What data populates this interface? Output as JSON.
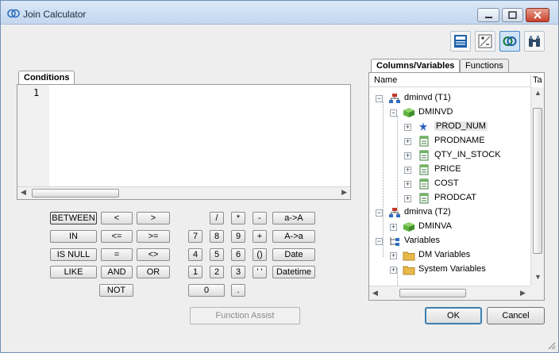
{
  "window": {
    "title": "Join Calculator"
  },
  "toolbar": {
    "buttons": [
      {
        "name": "sql-icon",
        "active": false
      },
      {
        "name": "calculator-icon",
        "active": false
      },
      {
        "name": "join-rings-icon",
        "active": true
      },
      {
        "name": "binoculars-icon",
        "active": false
      }
    ]
  },
  "conditions": {
    "tab_label": "Conditions",
    "line_numbers": [
      "1"
    ],
    "text": ""
  },
  "keypad": {
    "ops": [
      [
        "BETWEEN",
        "<",
        ">"
      ],
      [
        "IN",
        "<=",
        ">="
      ],
      [
        "IS NULL",
        "=",
        "<>"
      ],
      [
        "LIKE",
        "AND",
        "OR"
      ],
      [
        "NOT"
      ]
    ],
    "numpad_row1": [
      "/",
      "*",
      "-",
      "a->A"
    ],
    "numpad_row2": [
      "7",
      "8",
      "9",
      "+",
      "A->a"
    ],
    "numpad_row3": [
      "4",
      "5",
      "6",
      "()",
      "Date"
    ],
    "numpad_row4": [
      "1",
      "2",
      "3",
      "' '",
      "Datetime"
    ],
    "numpad_row5": [
      "0",
      "."
    ],
    "function_assist": "Function Assist"
  },
  "right_panel": {
    "tabs": [
      "Columns/Variables",
      "Functions"
    ],
    "columns": [
      "Name",
      "Ta"
    ],
    "tree": [
      {
        "label": "dminvd (T1)",
        "icon": "table-tree-icon",
        "level": 0,
        "expander": "−"
      },
      {
        "label": "DMINVD",
        "icon": "dataset-icon",
        "level": 1,
        "expander": "−"
      },
      {
        "label": "PROD_NUM",
        "icon": "key-column-icon",
        "level": 2,
        "expander": "+"
      },
      {
        "label": "PRODNAME",
        "icon": "column-icon",
        "level": 2,
        "expander": "+"
      },
      {
        "label": "QTY_IN_STOCK",
        "icon": "column-icon",
        "level": 2,
        "expander": "+"
      },
      {
        "label": "PRICE",
        "icon": "column-icon",
        "level": 2,
        "expander": "+"
      },
      {
        "label": "COST",
        "icon": "column-icon",
        "level": 2,
        "expander": "+"
      },
      {
        "label": "PRODCAT",
        "icon": "column-icon",
        "level": 2,
        "expander": "+"
      },
      {
        "label": "dminva (T2)",
        "icon": "table-tree-icon",
        "level": 0,
        "expander": "−"
      },
      {
        "label": "DMINVA",
        "icon": "dataset-icon",
        "level": 1,
        "expander": "+"
      },
      {
        "label": "Variables",
        "icon": "variables-icon",
        "level": 0,
        "expander": "−"
      },
      {
        "label": "DM Variables",
        "icon": "folder-icon",
        "level": 1,
        "expander": "+"
      },
      {
        "label": "System Variables",
        "icon": "folder-icon",
        "level": 1,
        "expander": "+"
      }
    ]
  },
  "dialog": {
    "ok": "OK",
    "cancel": "Cancel"
  },
  "colors": {
    "accent": "#3c7fb1",
    "folder": "#e8b84a",
    "dataset": "#5fb33f",
    "tree_node": "#c0392b"
  }
}
